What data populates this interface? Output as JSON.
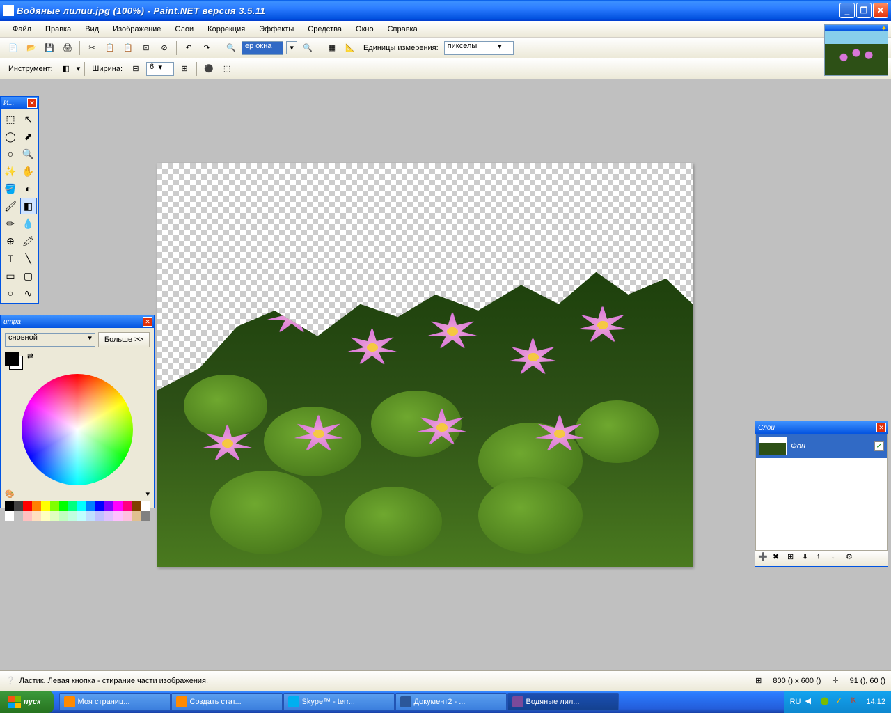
{
  "titlebar": {
    "text": "Водяные лилии.jpg (100%) - Paint.NET версия 3.5.11"
  },
  "menu": {
    "file": "Файл",
    "edit": "Правка",
    "view": "Вид",
    "image": "Изображение",
    "layers": "Слои",
    "adjustments": "Коррекция",
    "effects": "Эффекты",
    "tools": "Средства",
    "window": "Окно",
    "help": "Справка"
  },
  "toolbar1": {
    "zoom_select": "ер окна",
    "units_label": "Единицы измерения:",
    "units_value": "пикселы"
  },
  "toolbar2": {
    "tool_label": "Инструмент:",
    "width_label": "Ширина:",
    "width_value": "6"
  },
  "panels": {
    "tools_title": "И...",
    "colors_title": "итра",
    "colors_mode": "сновной",
    "more_btn": "Больше >>",
    "layers_title": "Слои",
    "layer_name": "Фон"
  },
  "status": {
    "hint": "Ластик. Левая кнопка - стирание части изображения.",
    "size": "800 () x 600 ()",
    "pos": "91 (), 60 ()"
  },
  "taskbar": {
    "start": "пуск",
    "items": [
      "Моя страниц...",
      "Создать стат...",
      "Skype™ - terr...",
      "Документ2 - ...",
      "Водяные лил..."
    ],
    "lang": "RU",
    "time": "14:12"
  },
  "swatch_colors": [
    "#000000",
    "#404040",
    "#ff0000",
    "#ff8000",
    "#ffff00",
    "#80ff00",
    "#00ff00",
    "#00ff80",
    "#00ffff",
    "#0080ff",
    "#0000ff",
    "#8000ff",
    "#ff00ff",
    "#ff0080",
    "#804000",
    "#ffffff"
  ]
}
